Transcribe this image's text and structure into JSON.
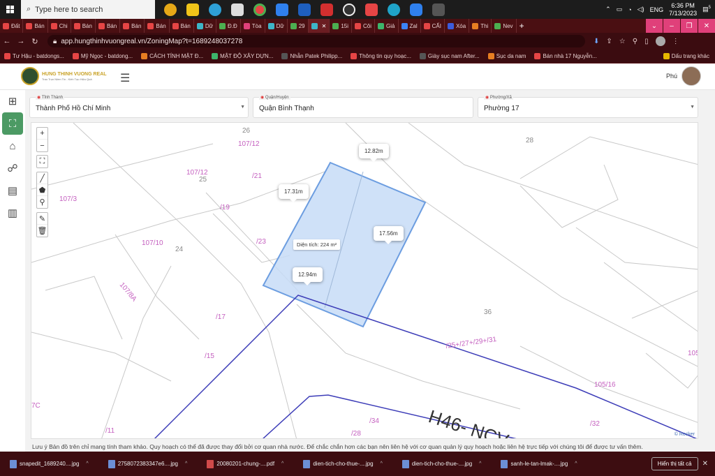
{
  "taskbar": {
    "search_placeholder": "Type here to search",
    "tray": {
      "lang": "ENG",
      "time": "6:36 PM",
      "date": "7/13/2023",
      "notif_count": "5"
    }
  },
  "browser_tabs": [
    {
      "label": "Đất",
      "color": "#e64545"
    },
    {
      "label": "Bán",
      "color": "#e64545"
    },
    {
      "label": "Chi",
      "color": "#e64545"
    },
    {
      "label": "Bán",
      "color": "#e64545"
    },
    {
      "label": "Bán",
      "color": "#e64545"
    },
    {
      "label": "Bán",
      "color": "#e64545"
    },
    {
      "label": "Bán",
      "color": "#e64545"
    },
    {
      "label": "Bán",
      "color": "#e64545"
    },
    {
      "label": "Dữ",
      "color": "#3db5c8"
    },
    {
      "label": "Đ.Đ",
      "color": "#4caf50"
    },
    {
      "label": "Tòa",
      "color": "#e0407a"
    },
    {
      "label": "Dữ",
      "color": "#3db5c8"
    },
    {
      "label": "29",
      "color": "#4caf50"
    },
    {
      "label": "",
      "color": "#3db5c8",
      "active": true
    },
    {
      "label": "15i",
      "color": "#4caf50"
    },
    {
      "label": "Côi",
      "color": "#e64545"
    },
    {
      "label": "Giả",
      "color": "#3db56b"
    },
    {
      "label": "Zal",
      "color": "#3b82f6"
    },
    {
      "label": "CẤI",
      "color": "#e64545"
    },
    {
      "label": "Xóa",
      "color": "#3b5bdb"
    },
    {
      "label": "Thi",
      "color": "#e67e22"
    },
    {
      "label": "Nev",
      "color": "#4caf50"
    }
  ],
  "address": {
    "url": "app.hungthinhvuongreal.vn/ZoningMap?t=1689248037278"
  },
  "bookmarks": [
    {
      "label": "Tư Hậu - batdongs...",
      "color": "#e64545"
    },
    {
      "label": "Mỹ Ngọc - batdong...",
      "color": "#e64545"
    },
    {
      "label": "CÁCH TÍNH MẬT Đ...",
      "color": "#e67e22"
    },
    {
      "label": "MẬT ĐỘ XÂY DỰN...",
      "color": "#3db56b"
    },
    {
      "label": "Nhẫn Patek Philipp...",
      "color": "#555"
    },
    {
      "label": "Thông tin quy hoạc...",
      "color": "#e64545"
    },
    {
      "label": "Giày sục nam After...",
      "color": "#555"
    },
    {
      "label": "Sục da nam",
      "color": "#e67e22"
    },
    {
      "label": "Bán nhà 17 Nguyễn...",
      "color": "#e64545"
    },
    {
      "label": "Dấu trang khác",
      "color": "#e6b800"
    }
  ],
  "app": {
    "logo_title": "HUNG THINH VUONG REAL",
    "logo_subtitle": "Trao Trọn Niềm Tin - Kiến Tạo Hiệu Quả",
    "user_name": "Phú"
  },
  "filters": {
    "province": {
      "label": "Tỉnh Thành",
      "value": "Thành Phố Hồ Chí Minh"
    },
    "district": {
      "label": "Quận/Huyện",
      "value": "Quận Bình Thạnh"
    },
    "ward": {
      "label": "Phường/Xã",
      "value": "Phường 17"
    }
  },
  "map": {
    "measurements": {
      "top": "12.82m",
      "left": "17.31m",
      "right": "17.56m",
      "bottom": "12.94m"
    },
    "area_text": "Diện tích: 224 m²",
    "parcel_labels": [
      "26",
      "107/12",
      "28",
      "107/12",
      "25",
      "/21",
      "107/3",
      "/19",
      "/23",
      "107/10",
      "24",
      "107/8A",
      "/17",
      "36",
      "/25+/27+/29+/31",
      "/15",
      "105",
      "105/16",
      "H46- NCV",
      "/34",
      "/32",
      "/28",
      "/11",
      "7C"
    ],
    "attribution": "© Rocker"
  },
  "notice": "Lưu ý Bản đồ trên chỉ mang tính tham khảo. Quy hoạch có thể đã được thay đổi bởi cơ quan nhà nước. Để chắc chắn hơn các bạn nên liên hệ với cơ quan quản lý quy hoạch hoặc liên hệ trực tiếp với chúng tôi để được tư vấn thêm.",
  "downloads": {
    "files": [
      {
        "name": "snapedit_1689240....jpg",
        "type": "img"
      },
      {
        "name": "2758072383347e6....jpg",
        "type": "img"
      },
      {
        "name": "20080201-chung-....pdf",
        "type": "pdf"
      },
      {
        "name": "dien-tich-cho-thue-....jpg",
        "type": "img"
      },
      {
        "name": "dien-tich-cho-thue-....jpg",
        "type": "img"
      },
      {
        "name": "sanh-le-tan-lmak-....jpg",
        "type": "img"
      }
    ],
    "show_all": "Hiển thị tất cả"
  }
}
